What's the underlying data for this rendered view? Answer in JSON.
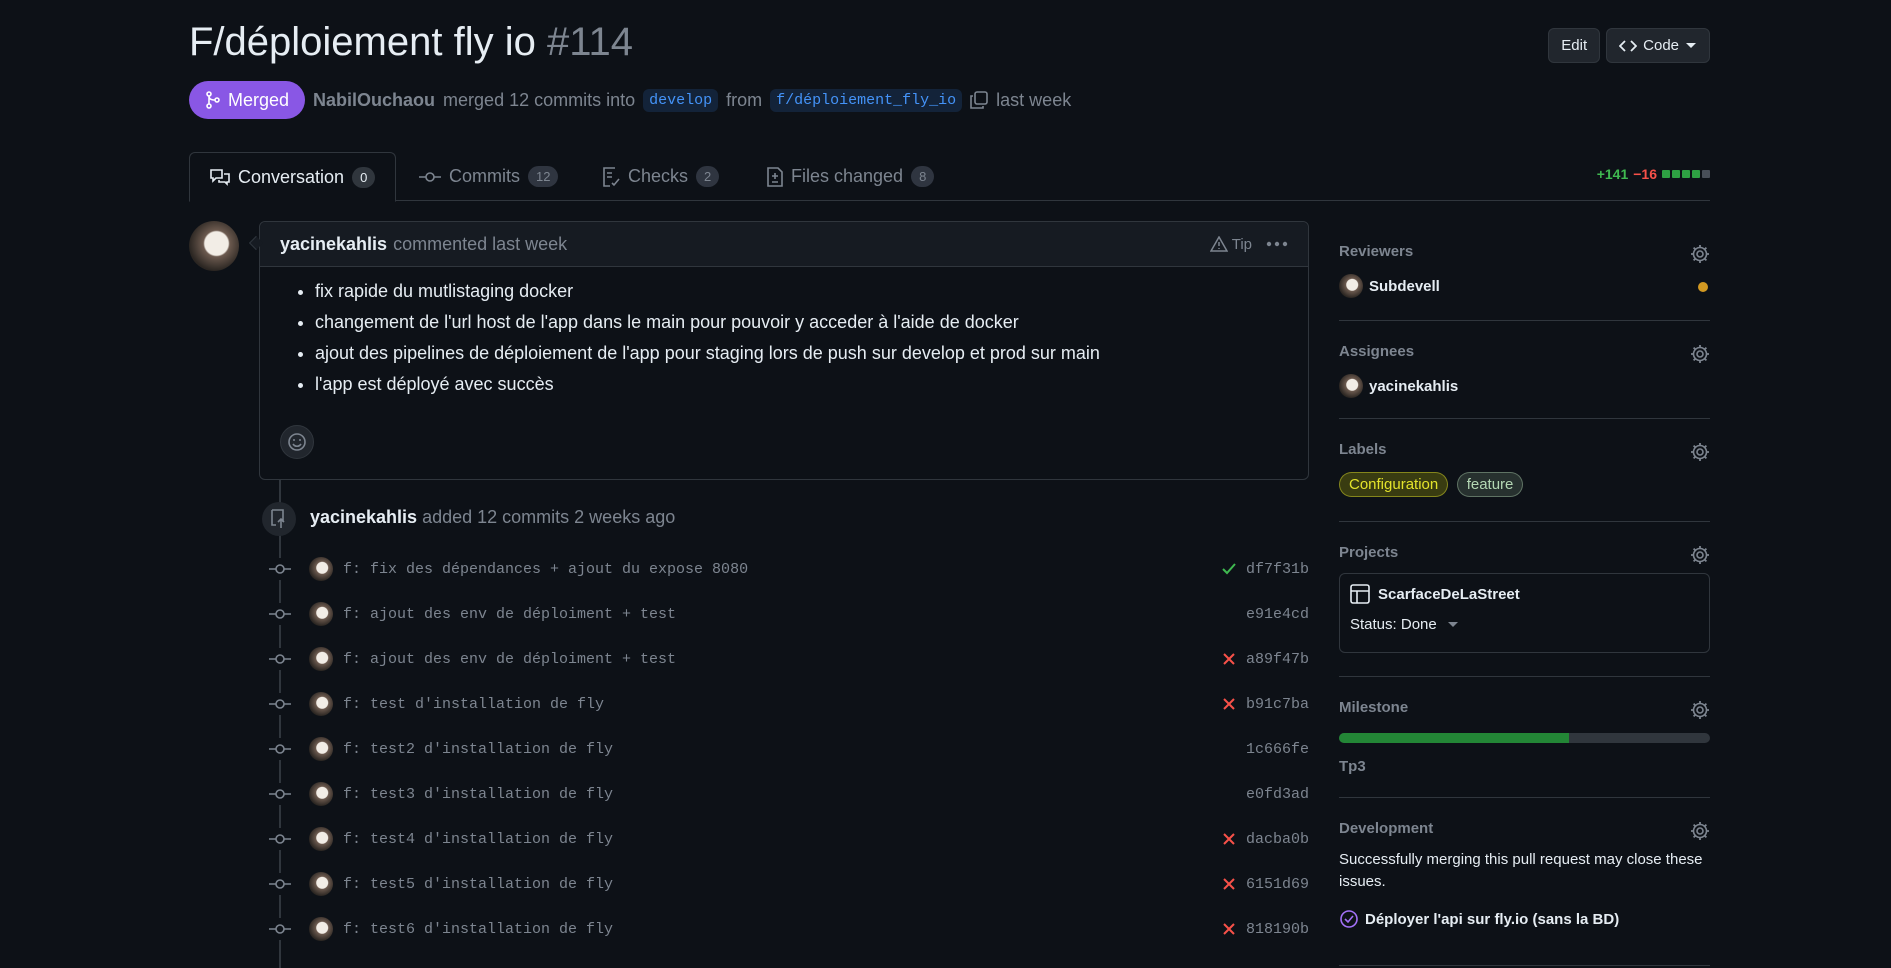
{
  "header": {
    "title": "F/déploiement fly io",
    "number": "#114",
    "edit_label": "Edit",
    "code_label": "Code"
  },
  "meta": {
    "status": "Merged",
    "author": "NabilOuchaou",
    "merged_text": "merged 12 commits into",
    "base_branch": "develop",
    "from_text": "from",
    "head_branch": "f/déploiement_fly_io",
    "time": "last week"
  },
  "tabs": [
    {
      "label": "Conversation",
      "count": "0"
    },
    {
      "label": "Commits",
      "count": "12"
    },
    {
      "label": "Checks",
      "count": "2"
    },
    {
      "label": "Files changed",
      "count": "8"
    }
  ],
  "diffstat": {
    "additions": "+141",
    "deletions": "−16",
    "green_blocks": 4,
    "total_blocks": 5
  },
  "comment": {
    "author": "yacinekahlis",
    "time_text": "commented last week",
    "tip_label": "Tip",
    "items": [
      "fix rapide du mutlistaging docker",
      "changement de l'url host de l'app dans le main pour pouvoir y acceder à l'aide de docker",
      "ajout des pipelines de déploiement de l'app pour staging lors de push sur develop et prod sur main",
      "l'app est déployé avec succès"
    ]
  },
  "push_event": {
    "author": "yacinekahlis",
    "text": "added 12 commits 2 weeks ago"
  },
  "commits": [
    {
      "message": "f: fix des dépendances + ajout du expose 8080",
      "sha": "df7f31b",
      "status": "success"
    },
    {
      "message": "f: ajout des env de déploiment + test",
      "sha": "e91e4cd",
      "status": "none"
    },
    {
      "message": "f: ajout des env de déploiment + test",
      "sha": "a89f47b",
      "status": "failure"
    },
    {
      "message": "f: test d'installation de fly",
      "sha": "b91c7ba",
      "status": "failure"
    },
    {
      "message": "f: test2 d'installation de fly",
      "sha": "1c666fe",
      "status": "none"
    },
    {
      "message": "f: test3 d'installation de fly",
      "sha": "e0fd3ad",
      "status": "none"
    },
    {
      "message": "f: test4 d'installation de fly",
      "sha": "dacba0b",
      "status": "failure"
    },
    {
      "message": "f: test5 d'installation de fly",
      "sha": "6151d69",
      "status": "failure"
    },
    {
      "message": "f: test6 d'installation de fly",
      "sha": "818190b",
      "status": "failure"
    }
  ],
  "sidebar": {
    "reviewers": {
      "title": "Reviewers",
      "name": "Subdevell"
    },
    "assignees": {
      "title": "Assignees",
      "name": "yacinekahlis"
    },
    "labels": {
      "title": "Labels",
      "items": [
        "Configuration",
        "feature"
      ]
    },
    "projects": {
      "title": "Projects",
      "name": "ScarfaceDeLaStreet",
      "status": "Status: Done"
    },
    "milestone": {
      "title": "Milestone",
      "name": "Tp3",
      "progress": 0.62
    },
    "development": {
      "title": "Development",
      "text": "Successfully merging this pull request may close these issues.",
      "issue": "Déployer l'api sur fly.io (sans la BD)"
    }
  },
  "colors": {
    "merged": "#8957e5",
    "success": "#3fb950",
    "failure": "#f85149",
    "link": "#4493f8"
  }
}
